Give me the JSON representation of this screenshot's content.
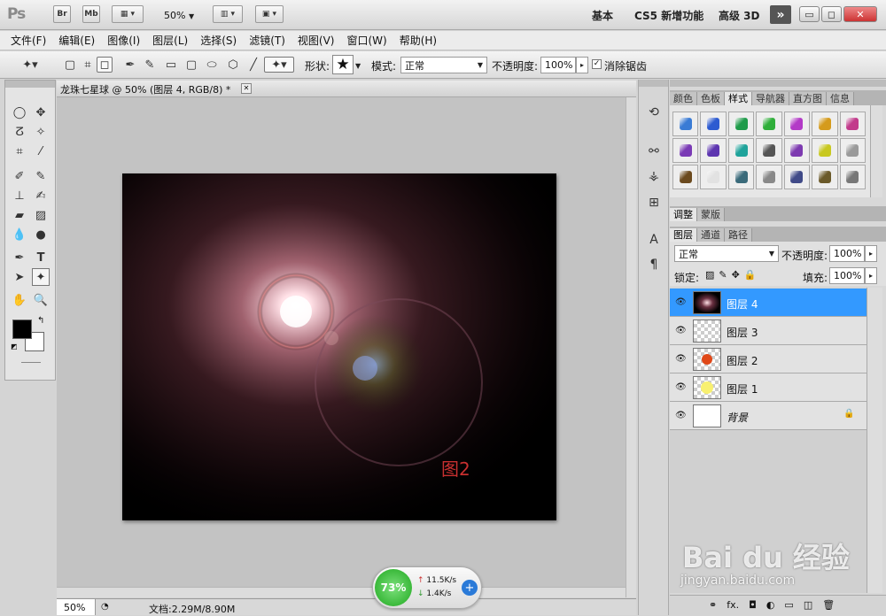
{
  "app": {
    "logo": "Ps",
    "bridge": "Br",
    "minibridge": "Mb",
    "zoom": "50%",
    "workspaces": [
      "基本",
      "CS5 新增功能",
      "高级 3D"
    ],
    "more": "»"
  },
  "window": {
    "min": "▭",
    "restore": "◻",
    "close": "✕"
  },
  "menu": [
    "文件(F)",
    "编辑(E)",
    "图像(I)",
    "图层(L)",
    "选择(S)",
    "滤镜(T)",
    "视图(V)",
    "窗口(W)",
    "帮助(H)"
  ],
  "options": {
    "shape_label": "形状:",
    "mode_label": "模式:",
    "mode_value": "正常",
    "opacity_label": "不透明度:",
    "opacity_value": "100%",
    "antialias_label": "消除锯齿"
  },
  "document": {
    "tab_title": "龙珠七星球 @ 50% (图层 4, RGB/8) *",
    "close": "✕",
    "overlay_text": "图2"
  },
  "status": {
    "zoom": "50%",
    "doc_size": "文档:2.29M/8.90M"
  },
  "net_widget": {
    "percent": "73%",
    "up": "11.5K/s",
    "down": "1.4K/s"
  },
  "panels": {
    "top_tabs": [
      "颜色",
      "色板",
      "样式",
      "导航器",
      "直方图",
      "信息"
    ],
    "top_active": "样式",
    "mid_tabs": [
      "调整",
      "蒙版"
    ],
    "layer_tabs": [
      "图层",
      "通道",
      "路径"
    ],
    "blend_mode": "正常",
    "opacity_label": "不透明度:",
    "opacity_value": "100%",
    "lock_label": "锁定:",
    "fill_label": "填充:",
    "fill_value": "100%",
    "layers": [
      {
        "name": "图层 4",
        "selected": true
      },
      {
        "name": "图层 3",
        "selected": false
      },
      {
        "name": "图层 2",
        "selected": false
      },
      {
        "name": "图层 1",
        "selected": false
      },
      {
        "name": "背景",
        "selected": false
      }
    ]
  },
  "styles_colors": [
    "#3a7bd5",
    "#2d5bd1",
    "#1f9b4a",
    "#2fae3a",
    "#b33ac7",
    "#d59b1c",
    "#c23a8b",
    "#7a3ab5",
    "#5d35b0",
    "#1fa39b",
    "#555555",
    "#7d3ab0",
    "#c8c820",
    "#9a9a9a",
    "#6b4a1e",
    "#e2e2e2",
    "#3a6a7a",
    "#888888",
    "#404a88",
    "#6b5a2a",
    "#777777"
  ],
  "watermark": {
    "brand": "Bai du 经验",
    "url": "jingyan.baidu.com"
  }
}
